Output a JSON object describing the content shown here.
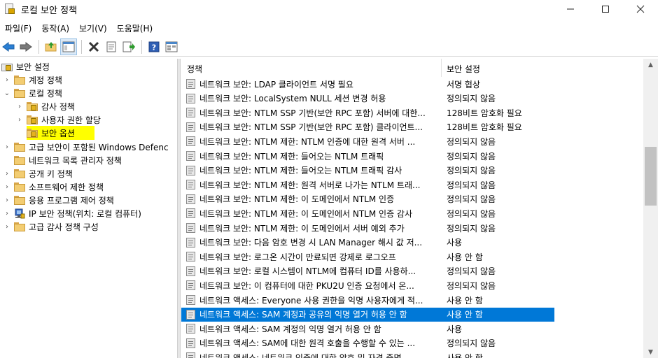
{
  "window": {
    "title": "로컬 보안 정책",
    "controls": [
      "—",
      "☐",
      "✕"
    ]
  },
  "menu": [
    "파일(F)",
    "동작(A)",
    "보기(V)",
    "도움말(H)"
  ],
  "toolbar": {
    "icons": [
      "back-icon",
      "forward-icon",
      "up-folder-icon",
      "show-hide-tree-icon",
      "delete-icon",
      "properties-icon",
      "export-list-icon",
      "help-icon",
      "view-icon"
    ]
  },
  "tree": [
    {
      "label": "보안 설정",
      "level": 0,
      "expander": "",
      "icon": "root"
    },
    {
      "label": "계정 정책",
      "level": 1,
      "expander": "›",
      "icon": "folder"
    },
    {
      "label": "로컬 정책",
      "level": 1,
      "expander": "⌄",
      "icon": "folder"
    },
    {
      "label": "감사 정책",
      "level": 2,
      "expander": "›",
      "icon": "folder"
    },
    {
      "label": "사용자 권한 할당",
      "level": 2,
      "expander": "›",
      "icon": "folder"
    },
    {
      "label": "보안 옵션",
      "level": 2,
      "expander": "",
      "icon": "folder",
      "highlighted": true
    },
    {
      "label": "고급 보안이 포함된 Windows Defenc",
      "level": 1,
      "expander": "›",
      "icon": "folder"
    },
    {
      "label": "네트워크 목록 관리자 정책",
      "level": 1,
      "expander": "",
      "icon": "folder"
    },
    {
      "label": "공개 키 정책",
      "level": 1,
      "expander": "›",
      "icon": "folder"
    },
    {
      "label": "소프트웨어 제한 정책",
      "level": 1,
      "expander": "›",
      "icon": "folder"
    },
    {
      "label": "응용 프로그램 제어 정책",
      "level": 1,
      "expander": "›",
      "icon": "folder"
    },
    {
      "label": "IP 보안 정책(위치: 로컬 컴퓨터)",
      "level": 1,
      "expander": "›",
      "icon": "ipsec"
    },
    {
      "label": "고급 감사 정책 구성",
      "level": 1,
      "expander": "›",
      "icon": "folder"
    }
  ],
  "list": {
    "columns": [
      "정책",
      "보안 설정"
    ],
    "rows": [
      {
        "policy": "네트워크 보안: LDAP 클라이언트 서명 필요",
        "setting": "서명 협상"
      },
      {
        "policy": "네트워크 보안: LocalSystem NULL 세션 변경 허용",
        "setting": "정의되지 않음"
      },
      {
        "policy": "네트워크 보안: NTLM SSP 기반(보안 RPC 포함) 서버에 대한...",
        "setting": "128비트 암호화 필요"
      },
      {
        "policy": "네트워크 보안: NTLM SSP 기반(보안 RPC 포함) 클라이언트...",
        "setting": "128비트 암호화 필요"
      },
      {
        "policy": "네트워크 보안: NTLM 제한: NTLM 인증에 대한 원격 서버 ...",
        "setting": "정의되지 않음"
      },
      {
        "policy": "네트워크 보안: NTLM 제한: 들어오는 NTLM 트래픽",
        "setting": "정의되지 않음"
      },
      {
        "policy": "네트워크 보안: NTLM 제한: 들어오는 NTLM 트래픽 감사",
        "setting": "정의되지 않음"
      },
      {
        "policy": "네트워크 보안: NTLM 제한: 원격 서버로 나가는 NTLM 트래...",
        "setting": "정의되지 않음"
      },
      {
        "policy": "네트워크 보안: NTLM 제한: 이 도메인에서 NTLM 인증",
        "setting": "정의되지 않음"
      },
      {
        "policy": "네트워크 보안: NTLM 제한: 이 도메인에서 NTLM 인증 감사",
        "setting": "정의되지 않음"
      },
      {
        "policy": "네트워크 보안: NTLM 제한: 이 도메인에서 서버 예외 추가",
        "setting": "정의되지 않음"
      },
      {
        "policy": "네트워크 보안: 다음 암호 변경 시 LAN Manager 해시 값 저...",
        "setting": "사용"
      },
      {
        "policy": "네트워크 보안: 로그온 시간이 만료되면 강제로 로그오프",
        "setting": "사용 안 함"
      },
      {
        "policy": "네트워크 보안: 로컬 시스템이 NTLM에 컴퓨터 ID를 사용하...",
        "setting": "정의되지 않음"
      },
      {
        "policy": "네트워크 보안: 이 컴퓨터에 대한 PKU2U 인증 요청에서 온...",
        "setting": "정의되지 않음"
      },
      {
        "policy": "네트워크 액세스: Everyone 사용 권한을 익명 사용자에게 적...",
        "setting": "사용 안 함"
      },
      {
        "policy": "네트워크 액세스: SAM 계정과 공유의 익명 열거 허용 안 함",
        "setting": "사용 안 함",
        "selected": true
      },
      {
        "policy": "네트워크 액세스: SAM 계정의 익명 열거 허용 안 함",
        "setting": "사용"
      },
      {
        "policy": "네트워크 액세스: SAM에 대한 원격 호출을 수행할 수 있는 ...",
        "setting": "정의되지 않음"
      },
      {
        "policy": "네트워크 액세스: 네트워크 인증에 대한 암호 및 자격 증명...",
        "setting": "사용 안 함"
      }
    ]
  },
  "colors": {
    "selection": "#0078d7",
    "highlight": "#ffff00"
  }
}
